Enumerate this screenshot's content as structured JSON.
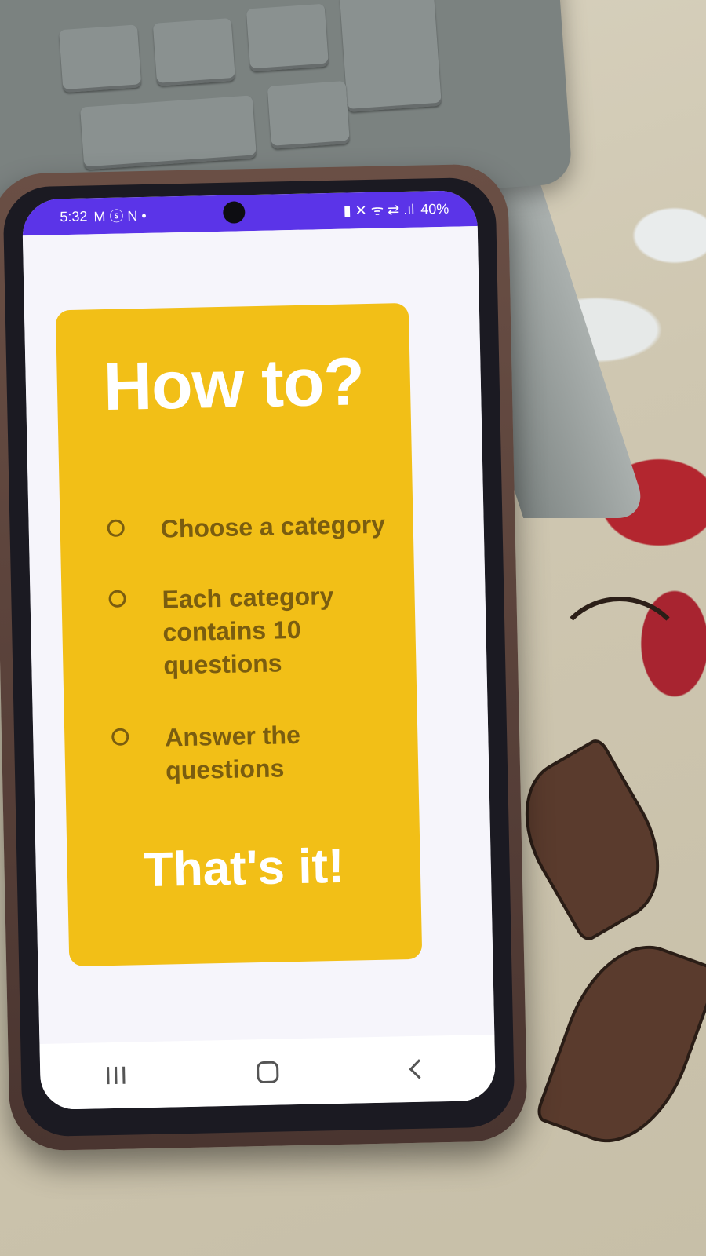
{
  "status_bar": {
    "time": "5:32",
    "left_icons": "M ⓢ N •",
    "right_icons": "▮ ✕ ᯤ ⇄ .ıl",
    "battery": "40%"
  },
  "card": {
    "title": "How to?",
    "steps": [
      "Choose a category",
      "Each category contains 10 questions",
      "Answer the questions"
    ],
    "closing": "That's it!"
  },
  "nav_bar": {
    "buttons": [
      "recents-icon",
      "home-icon",
      "back-icon"
    ]
  },
  "colors": {
    "status_bar": "#5b34e8",
    "card_background": "#f2bf17",
    "card_text_dark": "#7a5d10",
    "card_text_light": "#ffffff",
    "screen_background": "#f6f5fb"
  }
}
